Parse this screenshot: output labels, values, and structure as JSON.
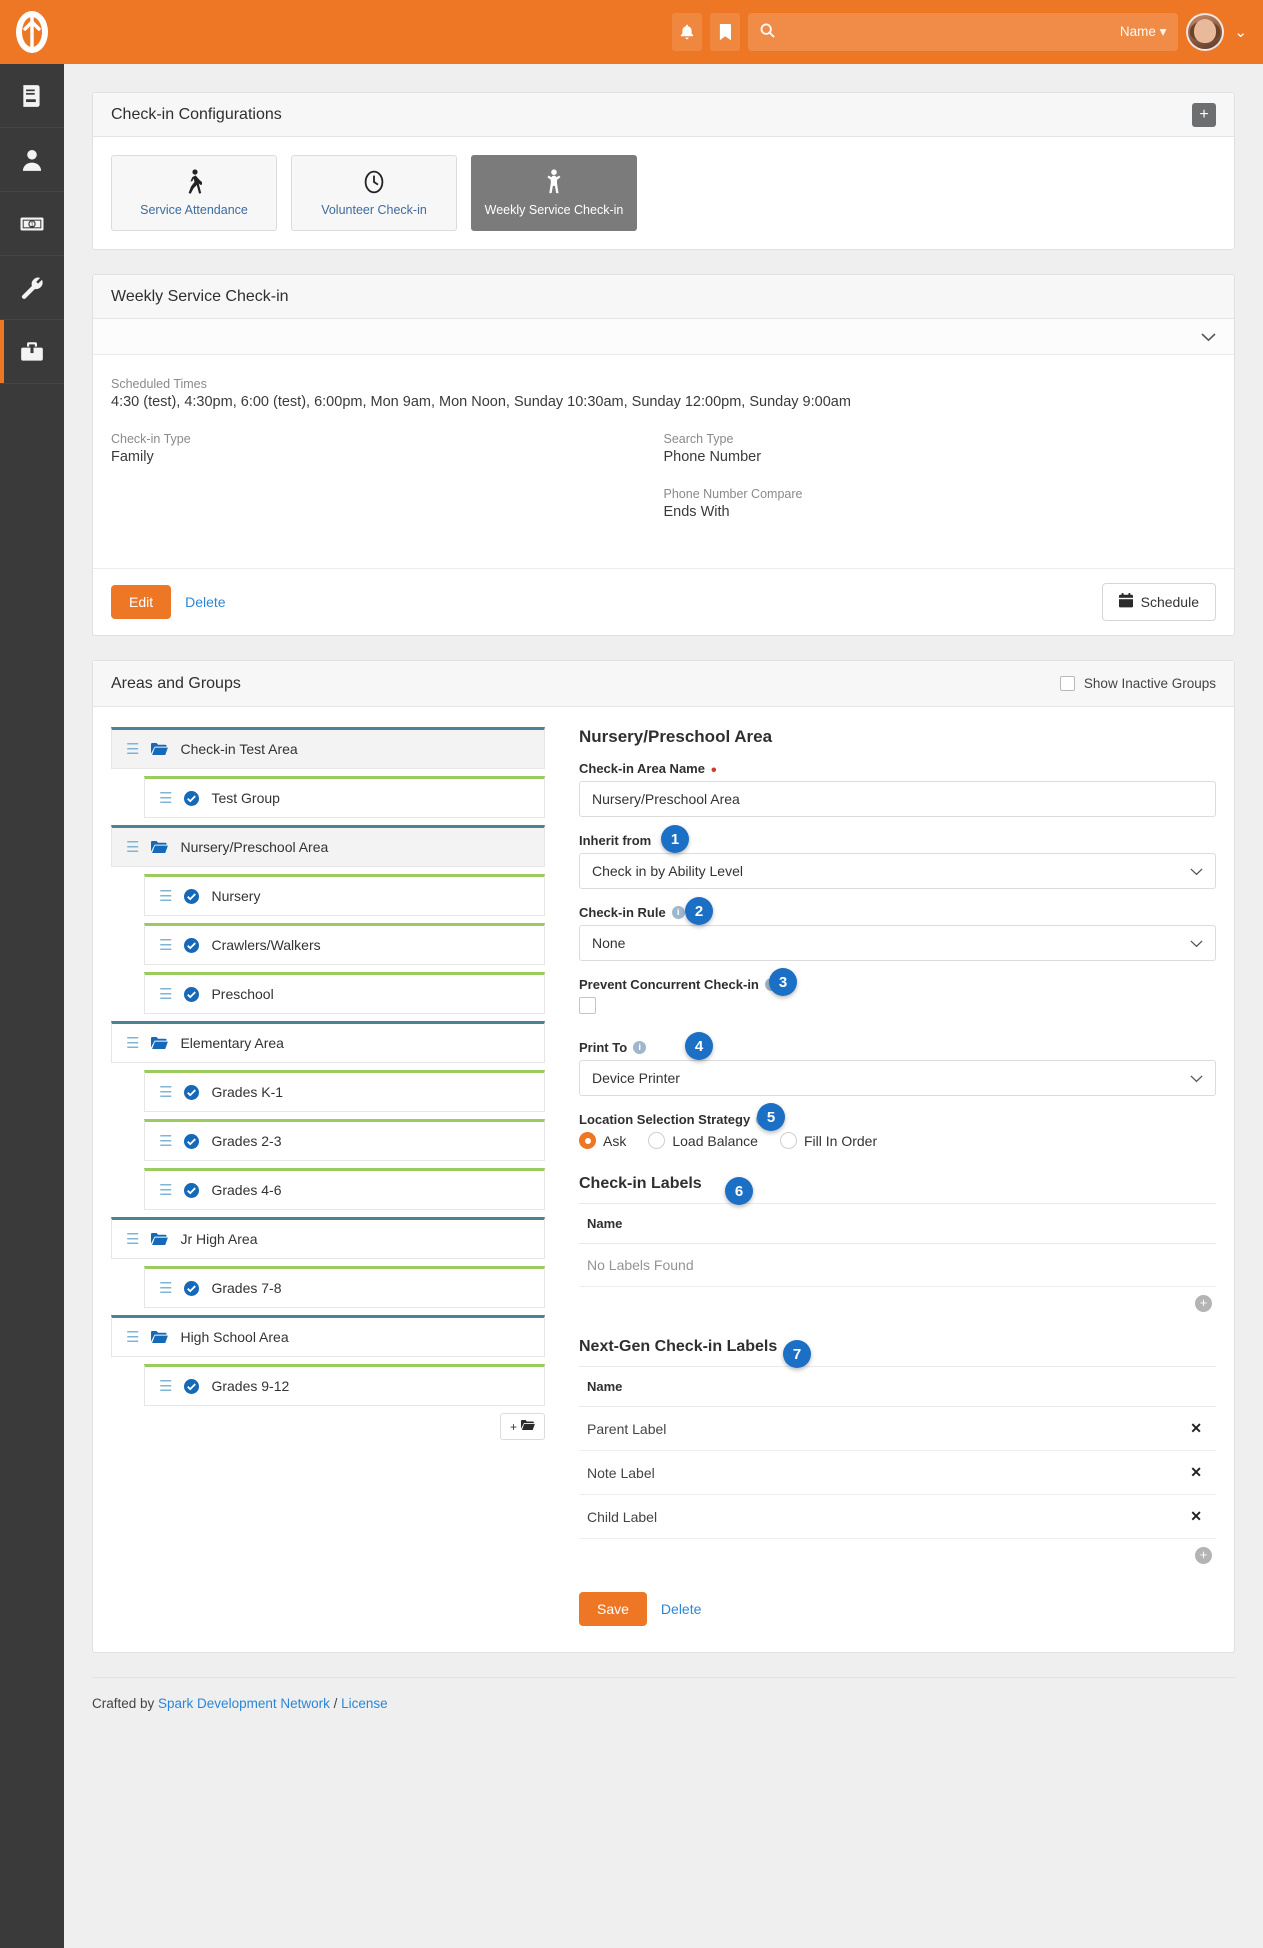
{
  "topbar": {
    "logo_name": "rock-logo",
    "notification_icon": "bell-icon",
    "bookmark_icon": "bookmark-icon",
    "search_icon": "search-icon",
    "search_placeholder": "",
    "search_value": "",
    "search_scope_label": "Name",
    "avatar_name": "user-avatar",
    "user_caret": "⌄",
    "accent_color": "#ee7725"
  },
  "sidebar": {
    "items": [
      {
        "name": "sidebar-item-cms",
        "icon": "book-icon"
      },
      {
        "name": "sidebar-item-people",
        "icon": "person-icon"
      },
      {
        "name": "sidebar-item-finance",
        "icon": "money-bill-icon"
      },
      {
        "name": "sidebar-item-tools",
        "icon": "wrench-icon"
      },
      {
        "name": "sidebar-item-admin",
        "icon": "toolbox-icon"
      }
    ],
    "active_index": 4
  },
  "configurations_panel": {
    "title": "Check-in Configurations",
    "add_button_label": "+",
    "tiles": [
      {
        "label": "Service Attendance",
        "icon": "walking-icon",
        "selected": false
      },
      {
        "label": "Volunteer Check-in",
        "icon": "clock-icon",
        "selected": false
      },
      {
        "label": "Weekly Service Check-in",
        "icon": "child-icon",
        "selected": true
      }
    ]
  },
  "detail_panel": {
    "title": "Weekly Service Check-in",
    "collapse_icon": "chevron-down-icon",
    "fields": [
      {
        "label": "Scheduled Times",
        "value": "4:30 (test), 4:30pm, 6:00 (test), 6:00pm, Mon 9am, Mon Noon, Sunday 10:30am, Sunday 12:00pm, Sunday 9:00am"
      }
    ],
    "left_fields": [
      {
        "label": "Check-in Type",
        "value": "Family"
      }
    ],
    "right_fields": [
      {
        "label": "Search Type",
        "value": "Phone Number"
      },
      {
        "label": "Phone Number Compare",
        "value": "Ends With"
      }
    ],
    "edit_label": "Edit",
    "delete_label": "Delete",
    "schedule_label": "Schedule",
    "schedule_icon": "calendar-icon"
  },
  "areas_panel": {
    "title": "Areas and Groups",
    "show_inactive_label": "Show Inactive Groups",
    "show_inactive_checked": false,
    "tree": [
      {
        "type": "area",
        "label": "Check-in Test Area",
        "active": false,
        "icon": "folder-open-icon",
        "grip": "grip-icon"
      },
      {
        "type": "group",
        "label": "Test Group",
        "active": false,
        "icon": "check-circle-icon",
        "grip": "grip-icon"
      },
      {
        "type": "area",
        "label": "Nursery/Preschool Area",
        "active": true,
        "icon": "folder-open-icon",
        "grip": "grip-icon"
      },
      {
        "type": "group",
        "label": "Nursery",
        "active": false,
        "icon": "check-circle-icon",
        "grip": "grip-icon"
      },
      {
        "type": "group",
        "label": "Crawlers/Walkers",
        "active": false,
        "icon": "check-circle-icon",
        "grip": "grip-icon"
      },
      {
        "type": "group",
        "label": "Preschool",
        "active": false,
        "icon": "check-circle-icon",
        "grip": "grip-icon"
      },
      {
        "type": "area",
        "label": "Elementary Area",
        "active": false,
        "icon": "folder-open-icon",
        "grip": "grip-icon"
      },
      {
        "type": "group",
        "label": "Grades K-1",
        "active": false,
        "icon": "check-circle-icon",
        "grip": "grip-icon"
      },
      {
        "type": "group",
        "label": "Grades 2-3",
        "active": false,
        "icon": "check-circle-icon",
        "grip": "grip-icon"
      },
      {
        "type": "group",
        "label": "Grades 4-6",
        "active": false,
        "icon": "check-circle-icon",
        "grip": "grip-icon"
      },
      {
        "type": "area",
        "label": "Jr High Area",
        "active": false,
        "icon": "folder-open-icon",
        "grip": "grip-icon"
      },
      {
        "type": "group",
        "label": "Grades 7-8",
        "active": false,
        "icon": "check-circle-icon",
        "grip": "grip-icon"
      },
      {
        "type": "area",
        "label": "High School Area",
        "active": false,
        "icon": "folder-open-icon",
        "grip": "grip-icon"
      },
      {
        "type": "group",
        "label": "Grades 9-12",
        "active": false,
        "icon": "check-circle-icon",
        "grip": "grip-icon"
      }
    ],
    "add_area_label": "+",
    "add_area_icon": "folder-plus-icon"
  },
  "form": {
    "title": "Nursery/Preschool Area",
    "area_name": {
      "label": "Check-in Area Name",
      "required": true,
      "value": "Nursery/Preschool Area"
    },
    "inherit_from": {
      "label": "Inherit from",
      "value": "Check in by Ability Level",
      "badge": "1"
    },
    "checkin_rule": {
      "label": "Check-in Rule",
      "value": "None",
      "badge": "2",
      "info": true
    },
    "prevent_concurrent": {
      "label": "Prevent Concurrent Check-in",
      "checked": false,
      "badge": "3",
      "info": true
    },
    "print_to": {
      "label": "Print To",
      "value": "Device Printer",
      "badge": "4",
      "info": true
    },
    "location_strategy": {
      "label": "Location Selection Strategy",
      "badge": "5",
      "info": true,
      "required": true,
      "options": [
        "Ask",
        "Load Balance",
        "Fill In Order"
      ],
      "selected": "Ask"
    },
    "checkin_labels": {
      "title": "Check-in Labels",
      "badge": "6",
      "column_header": "Name",
      "empty_text": "No Labels Found",
      "rows": []
    },
    "nextgen_labels": {
      "title": "Next-Gen Check-in Labels",
      "badge": "7",
      "column_header": "Name",
      "rows": [
        "Parent Label",
        "Note Label",
        "Child Label"
      ],
      "remove_icon": "close-icon"
    },
    "save_label": "Save",
    "delete_label": "Delete",
    "add_icon": "circle-plus-icon"
  },
  "footer": {
    "prefix": "Crafted by ",
    "link1": "Spark Development Network",
    "separator": " / ",
    "link2": "License"
  }
}
